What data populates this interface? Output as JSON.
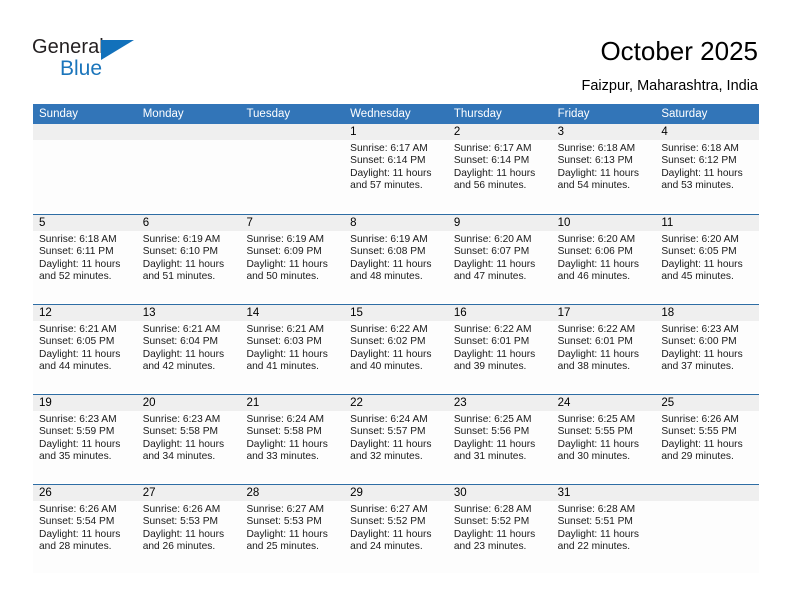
{
  "brand": {
    "name_top": "General",
    "name_bottom": "Blue",
    "triangle_color": "#1271bb",
    "text_color": "#231f20",
    "blue_color": "#1b75bb"
  },
  "header": {
    "title": "October 2025",
    "location": "Faizpur, Maharashtra, India"
  },
  "theme": {
    "header_blue": "#3275b8",
    "row_divider": "#2e6da4",
    "date_band": "#efefef",
    "cell_background": "#fdfdfd"
  },
  "weekdays": [
    "Sunday",
    "Monday",
    "Tuesday",
    "Wednesday",
    "Thursday",
    "Friday",
    "Saturday"
  ],
  "weeks": [
    [
      {
        "day": "",
        "sunrise": "",
        "sunset": "",
        "daylight_line1": "",
        "daylight_line2": ""
      },
      {
        "day": "",
        "sunrise": "",
        "sunset": "",
        "daylight_line1": "",
        "daylight_line2": ""
      },
      {
        "day": "",
        "sunrise": "",
        "sunset": "",
        "daylight_line1": "",
        "daylight_line2": ""
      },
      {
        "day": "1",
        "sunrise": "Sunrise: 6:17 AM",
        "sunset": "Sunset: 6:14 PM",
        "daylight_line1": "Daylight: 11 hours",
        "daylight_line2": "and 57 minutes."
      },
      {
        "day": "2",
        "sunrise": "Sunrise: 6:17 AM",
        "sunset": "Sunset: 6:14 PM",
        "daylight_line1": "Daylight: 11 hours",
        "daylight_line2": "and 56 minutes."
      },
      {
        "day": "3",
        "sunrise": "Sunrise: 6:18 AM",
        "sunset": "Sunset: 6:13 PM",
        "daylight_line1": "Daylight: 11 hours",
        "daylight_line2": "and 54 minutes."
      },
      {
        "day": "4",
        "sunrise": "Sunrise: 6:18 AM",
        "sunset": "Sunset: 6:12 PM",
        "daylight_line1": "Daylight: 11 hours",
        "daylight_line2": "and 53 minutes."
      }
    ],
    [
      {
        "day": "5",
        "sunrise": "Sunrise: 6:18 AM",
        "sunset": "Sunset: 6:11 PM",
        "daylight_line1": "Daylight: 11 hours",
        "daylight_line2": "and 52 minutes."
      },
      {
        "day": "6",
        "sunrise": "Sunrise: 6:19 AM",
        "sunset": "Sunset: 6:10 PM",
        "daylight_line1": "Daylight: 11 hours",
        "daylight_line2": "and 51 minutes."
      },
      {
        "day": "7",
        "sunrise": "Sunrise: 6:19 AM",
        "sunset": "Sunset: 6:09 PM",
        "daylight_line1": "Daylight: 11 hours",
        "daylight_line2": "and 50 minutes."
      },
      {
        "day": "8",
        "sunrise": "Sunrise: 6:19 AM",
        "sunset": "Sunset: 6:08 PM",
        "daylight_line1": "Daylight: 11 hours",
        "daylight_line2": "and 48 minutes."
      },
      {
        "day": "9",
        "sunrise": "Sunrise: 6:20 AM",
        "sunset": "Sunset: 6:07 PM",
        "daylight_line1": "Daylight: 11 hours",
        "daylight_line2": "and 47 minutes."
      },
      {
        "day": "10",
        "sunrise": "Sunrise: 6:20 AM",
        "sunset": "Sunset: 6:06 PM",
        "daylight_line1": "Daylight: 11 hours",
        "daylight_line2": "and 46 minutes."
      },
      {
        "day": "11",
        "sunrise": "Sunrise: 6:20 AM",
        "sunset": "Sunset: 6:05 PM",
        "daylight_line1": "Daylight: 11 hours",
        "daylight_line2": "and 45 minutes."
      }
    ],
    [
      {
        "day": "12",
        "sunrise": "Sunrise: 6:21 AM",
        "sunset": "Sunset: 6:05 PM",
        "daylight_line1": "Daylight: 11 hours",
        "daylight_line2": "and 44 minutes."
      },
      {
        "day": "13",
        "sunrise": "Sunrise: 6:21 AM",
        "sunset": "Sunset: 6:04 PM",
        "daylight_line1": "Daylight: 11 hours",
        "daylight_line2": "and 42 minutes."
      },
      {
        "day": "14",
        "sunrise": "Sunrise: 6:21 AM",
        "sunset": "Sunset: 6:03 PM",
        "daylight_line1": "Daylight: 11 hours",
        "daylight_line2": "and 41 minutes."
      },
      {
        "day": "15",
        "sunrise": "Sunrise: 6:22 AM",
        "sunset": "Sunset: 6:02 PM",
        "daylight_line1": "Daylight: 11 hours",
        "daylight_line2": "and 40 minutes."
      },
      {
        "day": "16",
        "sunrise": "Sunrise: 6:22 AM",
        "sunset": "Sunset: 6:01 PM",
        "daylight_line1": "Daylight: 11 hours",
        "daylight_line2": "and 39 minutes."
      },
      {
        "day": "17",
        "sunrise": "Sunrise: 6:22 AM",
        "sunset": "Sunset: 6:01 PM",
        "daylight_line1": "Daylight: 11 hours",
        "daylight_line2": "and 38 minutes."
      },
      {
        "day": "18",
        "sunrise": "Sunrise: 6:23 AM",
        "sunset": "Sunset: 6:00 PM",
        "daylight_line1": "Daylight: 11 hours",
        "daylight_line2": "and 37 minutes."
      }
    ],
    [
      {
        "day": "19",
        "sunrise": "Sunrise: 6:23 AM",
        "sunset": "Sunset: 5:59 PM",
        "daylight_line1": "Daylight: 11 hours",
        "daylight_line2": "and 35 minutes."
      },
      {
        "day": "20",
        "sunrise": "Sunrise: 6:23 AM",
        "sunset": "Sunset: 5:58 PM",
        "daylight_line1": "Daylight: 11 hours",
        "daylight_line2": "and 34 minutes."
      },
      {
        "day": "21",
        "sunrise": "Sunrise: 6:24 AM",
        "sunset": "Sunset: 5:58 PM",
        "daylight_line1": "Daylight: 11 hours",
        "daylight_line2": "and 33 minutes."
      },
      {
        "day": "22",
        "sunrise": "Sunrise: 6:24 AM",
        "sunset": "Sunset: 5:57 PM",
        "daylight_line1": "Daylight: 11 hours",
        "daylight_line2": "and 32 minutes."
      },
      {
        "day": "23",
        "sunrise": "Sunrise: 6:25 AM",
        "sunset": "Sunset: 5:56 PM",
        "daylight_line1": "Daylight: 11 hours",
        "daylight_line2": "and 31 minutes."
      },
      {
        "day": "24",
        "sunrise": "Sunrise: 6:25 AM",
        "sunset": "Sunset: 5:55 PM",
        "daylight_line1": "Daylight: 11 hours",
        "daylight_line2": "and 30 minutes."
      },
      {
        "day": "25",
        "sunrise": "Sunrise: 6:26 AM",
        "sunset": "Sunset: 5:55 PM",
        "daylight_line1": "Daylight: 11 hours",
        "daylight_line2": "and 29 minutes."
      }
    ],
    [
      {
        "day": "26",
        "sunrise": "Sunrise: 6:26 AM",
        "sunset": "Sunset: 5:54 PM",
        "daylight_line1": "Daylight: 11 hours",
        "daylight_line2": "and 28 minutes."
      },
      {
        "day": "27",
        "sunrise": "Sunrise: 6:26 AM",
        "sunset": "Sunset: 5:53 PM",
        "daylight_line1": "Daylight: 11 hours",
        "daylight_line2": "and 26 minutes."
      },
      {
        "day": "28",
        "sunrise": "Sunrise: 6:27 AM",
        "sunset": "Sunset: 5:53 PM",
        "daylight_line1": "Daylight: 11 hours",
        "daylight_line2": "and 25 minutes."
      },
      {
        "day": "29",
        "sunrise": "Sunrise: 6:27 AM",
        "sunset": "Sunset: 5:52 PM",
        "daylight_line1": "Daylight: 11 hours",
        "daylight_line2": "and 24 minutes."
      },
      {
        "day": "30",
        "sunrise": "Sunrise: 6:28 AM",
        "sunset": "Sunset: 5:52 PM",
        "daylight_line1": "Daylight: 11 hours",
        "daylight_line2": "and 23 minutes."
      },
      {
        "day": "31",
        "sunrise": "Sunrise: 6:28 AM",
        "sunset": "Sunset: 5:51 PM",
        "daylight_line1": "Daylight: 11 hours",
        "daylight_line2": "and 22 minutes."
      },
      {
        "day": "",
        "sunrise": "",
        "sunset": "",
        "daylight_line1": "",
        "daylight_line2": ""
      }
    ]
  ]
}
